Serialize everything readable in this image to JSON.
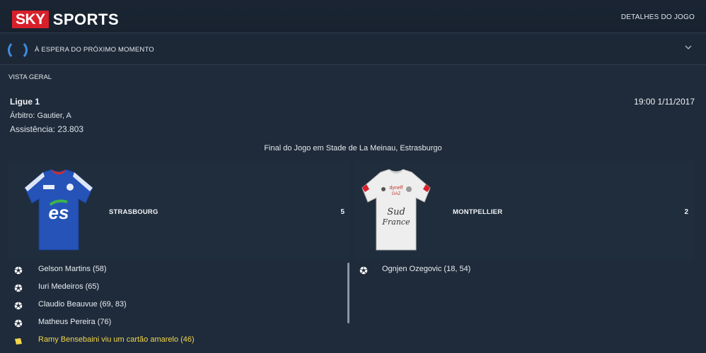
{
  "header": {
    "logo_brand": "SKY",
    "logo_product": "SPORTS",
    "match_details_label": "DETALHES DO JOGO"
  },
  "status": {
    "waiting_label": "À ESPERA DO PRÓXIMO MOMENTO"
  },
  "overview": {
    "title": "VISTA GERAL",
    "competition": "Ligue 1",
    "datetime": "19:00 1/11/2017",
    "referee": "Árbitro: Gautier, A",
    "attendance": "Assistência: 23.803",
    "venue": "Final do Jogo em Stade de La Meinau, Estrasburgo"
  },
  "home": {
    "name": "STRASBOURG",
    "score": "5",
    "kit_color": "#2553b8",
    "events": [
      {
        "type": "goal",
        "icon": "football-icon",
        "text": "Gelson Martins (58)"
      },
      {
        "type": "goal",
        "icon": "football-icon",
        "text": "Iuri Medeiros (65)"
      },
      {
        "type": "goal",
        "icon": "football-icon",
        "text": "Claudio Beauvue (69, 83)"
      },
      {
        "type": "goal",
        "icon": "football-icon",
        "text": "Matheus Pereira (76)"
      },
      {
        "type": "yellow-card",
        "icon": "yellow-card-icon",
        "text": "Ramy Bensebaini viu um cartão amarelo (46)"
      }
    ]
  },
  "away": {
    "name": "MONTPELLIER",
    "score": "2",
    "kit_color": "#eeeeee",
    "events": [
      {
        "type": "goal",
        "icon": "football-icon",
        "text": "Ognjen Ozegovic (18, 54)"
      }
    ]
  },
  "colors": {
    "background": "#1f2b3a",
    "accent": "#3d8de0",
    "brand_red": "#d8202a",
    "yellow_card": "#f2d64b"
  }
}
